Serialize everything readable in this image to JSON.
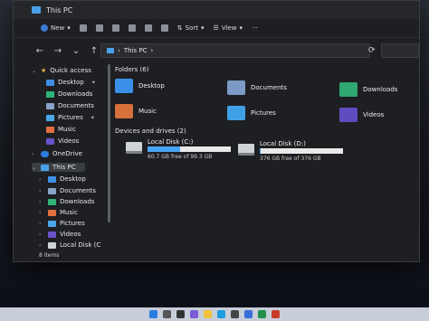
{
  "window": {
    "title": "This PC"
  },
  "commandbar": {
    "new_label": "New",
    "sort_label": "Sort",
    "view_label": "View"
  },
  "address": {
    "path": "This PC",
    "separator": "›"
  },
  "sidebar": {
    "quick_access_label": "Quick access",
    "quick_items": [
      {
        "label": "Desktop"
      },
      {
        "label": "Downloads"
      },
      {
        "label": "Documents"
      },
      {
        "label": "Pictures"
      },
      {
        "label": "Music"
      },
      {
        "label": "Videos"
      }
    ],
    "onedrive_label": "OneDrive",
    "thispc_label": "This PC",
    "pc_items": [
      {
        "label": "Desktop"
      },
      {
        "label": "Documents"
      },
      {
        "label": "Downloads"
      },
      {
        "label": "Music"
      },
      {
        "label": "Pictures"
      },
      {
        "label": "Videos"
      },
      {
        "label": "Local Disk (C:)"
      }
    ]
  },
  "content": {
    "folders_title": "Folders (6)",
    "folders": [
      {
        "label": "Desktop"
      },
      {
        "label": "Documents"
      },
      {
        "label": "Downloads"
      },
      {
        "label": "Music"
      },
      {
        "label": "Pictures"
      },
      {
        "label": "Videos"
      }
    ],
    "devices_title": "Devices and drives (2)",
    "drives": [
      {
        "name": "Local Disk (C:)",
        "free": "60.7 GB free of 99.3 GB",
        "used_fraction": 0.39
      },
      {
        "name": "Local Disk (D:)",
        "free": "376 GB free of 376 GB",
        "used_fraction": 0.01
      }
    ]
  },
  "status": {
    "items": "8 items"
  },
  "colors": {
    "accent": "#48a6f2",
    "window_bg": "#1e1f22"
  }
}
